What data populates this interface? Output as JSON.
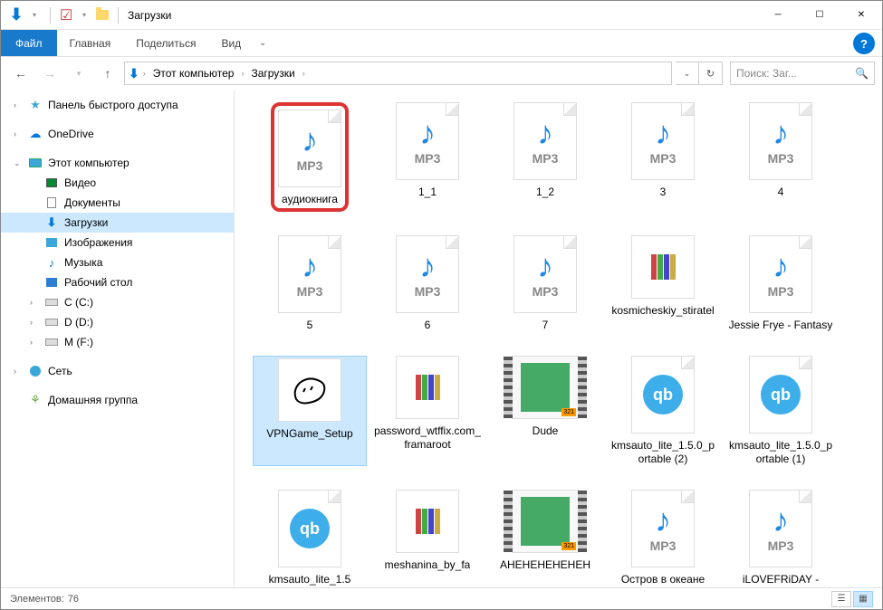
{
  "window": {
    "title": "Загрузки"
  },
  "ribbon": {
    "file": "Файл",
    "tabs": [
      "Главная",
      "Поделиться",
      "Вид"
    ]
  },
  "breadcrumb": {
    "items": [
      "Этот компьютер",
      "Загрузки"
    ]
  },
  "search": {
    "placeholder": "Поиск: Заг..."
  },
  "nav_tree": {
    "quick_access": "Панель быстрого доступа",
    "onedrive": "OneDrive",
    "this_pc": "Этот компьютер",
    "children": {
      "video": "Видео",
      "documents": "Документы",
      "downloads": "Загрузки",
      "pictures": "Изображения",
      "music": "Музыка",
      "desktop": "Рабочий стол",
      "drive_c": "C (C:)",
      "drive_d": "D (D:)",
      "drive_m": "M (F:)"
    },
    "network": "Сеть",
    "homegroup": "Домашняя группа"
  },
  "files": [
    {
      "name": "аудиокнига",
      "type": "mp3",
      "highlight": true
    },
    {
      "name": "1_1",
      "type": "mp3"
    },
    {
      "name": "1_2",
      "type": "mp3"
    },
    {
      "name": "3",
      "type": "mp3"
    },
    {
      "name": "4",
      "type": "mp3"
    },
    {
      "name": "5",
      "type": "mp3"
    },
    {
      "name": "6",
      "type": "mp3"
    },
    {
      "name": "7",
      "type": "mp3"
    },
    {
      "name": "kosmicheskiy_stiratel",
      "type": "rar"
    },
    {
      "name": "Jessie Frye - Fantasy",
      "type": "mp3"
    },
    {
      "name": "VPNGame_Setup",
      "type": "exe",
      "selected": true
    },
    {
      "name": "password_wtffix.com_framaroot",
      "type": "rar"
    },
    {
      "name": "Dude",
      "type": "video"
    },
    {
      "name": "kmsauto_lite_1.5.0_portable (2)",
      "type": "qb"
    },
    {
      "name": "kmsauto_lite_1.5.0_portable (1)",
      "type": "qb"
    },
    {
      "name": "kmsauto_lite_1.5",
      "type": "qb"
    },
    {
      "name": "meshanina_by_fa",
      "type": "rar"
    },
    {
      "name": "AHEHEHEHEHEH",
      "type": "video"
    },
    {
      "name": "Остров в океане",
      "type": "mp3"
    },
    {
      "name": "iLOVEFRiDAY -",
      "type": "mp3"
    }
  ],
  "status": {
    "items_label": "Элементов:",
    "count": "76"
  },
  "ext_labels": {
    "mp3": "MP3"
  }
}
